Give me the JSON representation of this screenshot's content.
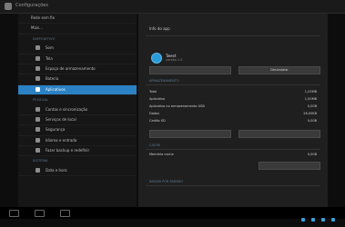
{
  "window": {
    "title": "Configurações"
  },
  "sidebar": {
    "items": [
      {
        "type": "item",
        "label": "Rede sem fio",
        "indent": true
      },
      {
        "type": "item",
        "label": "Mais...",
        "indent": true
      },
      {
        "type": "header",
        "label": "DISPOSITIVO"
      },
      {
        "type": "item",
        "label": "Som",
        "active": false
      },
      {
        "type": "item",
        "label": "Tela",
        "active": false
      },
      {
        "type": "item",
        "label": "Espaço de armazenamento",
        "active": false
      },
      {
        "type": "item",
        "label": "Bateria",
        "active": false
      },
      {
        "type": "item",
        "label": "Aplicativos",
        "active": true
      },
      {
        "type": "header",
        "label": "PESSOAL"
      },
      {
        "type": "item",
        "label": "Contas e sincronização",
        "active": false
      },
      {
        "type": "item",
        "label": "Serviços de local",
        "active": false
      },
      {
        "type": "item",
        "label": "Segurança",
        "active": false
      },
      {
        "type": "item",
        "label": "Idioma e entrada",
        "active": false
      },
      {
        "type": "item",
        "label": "Fazer backup e redefinir",
        "active": false
      },
      {
        "type": "header",
        "label": "SISTEMA"
      },
      {
        "type": "item",
        "label": "Data e hora",
        "active": false
      }
    ]
  },
  "content": {
    "heading": "Info do app",
    "app_name": "Tweet",
    "app_version": "versão 1.0",
    "buttons": {
      "force_stop": "",
      "uninstall": "Desinstalar"
    },
    "storage_header": "ARMAZENAMENTO",
    "storage_rows": [
      {
        "label": "Total",
        "value": "1,03MB"
      },
      {
        "label": "Aplicativo",
        "value": "1,00MB"
      },
      {
        "label": "Aplicativo no armazenamento USB",
        "value": "0,00B"
      },
      {
        "label": "Dados",
        "value": "28,00KB"
      },
      {
        "label": "Cartão SD",
        "value": "0,00B"
      }
    ],
    "storage_buttons": {
      "move": "",
      "clear_data": ""
    },
    "cache_header": "CACHE",
    "cache_row": {
      "label": "Memória cache",
      "value": "0,00B"
    },
    "clear_cache": "",
    "launch_header": "INICIAR POR PADRÃO"
  },
  "statusbar": {
    "clock": ""
  }
}
